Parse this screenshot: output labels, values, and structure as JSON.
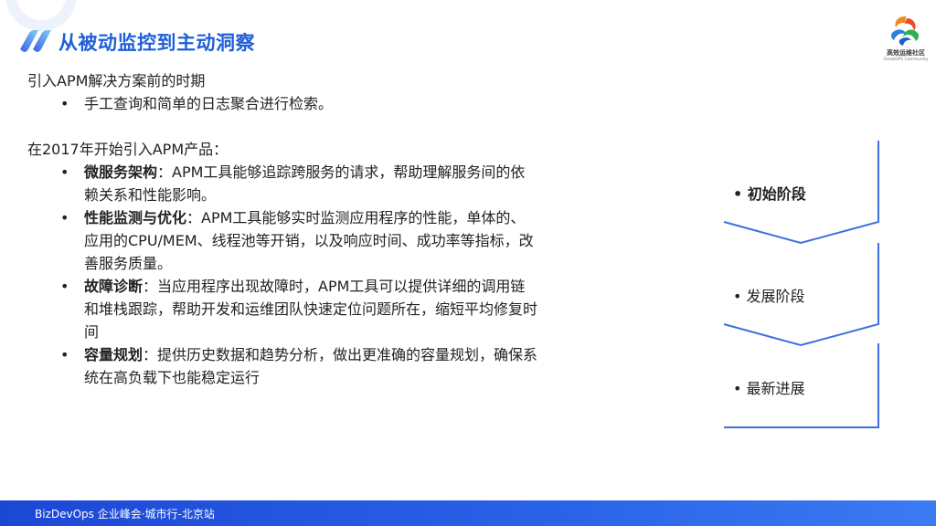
{
  "slide": {
    "title": "从被动监控到主动洞察",
    "footer": "BizDevOps 企业峰会·城市行-北京站"
  },
  "logo": {
    "name": "高效运维社区",
    "sub": "GreatOPS Community"
  },
  "content": {
    "pre_apm_heading": "引入APM解决方案前的时期",
    "pre_apm_bullets": [
      "手工查询和简单的日志聚合进行检索。"
    ],
    "apm_heading": "在2017年开始引入APM产品：",
    "apm_items": [
      {
        "term": "微服务架构",
        "lines": [
          "：APM工具能够追踪跨服务的请求，帮助理解服务间的依",
          "赖关系和性能影响。"
        ]
      },
      {
        "term": "性能监测与优化",
        "lines": [
          "：APM工具能够实时监测应用程序的性能，单体的、",
          "应用的CPU/MEM、线程池等开销，以及响应时间、成功率等指标，改",
          "善服务质量。"
        ]
      },
      {
        "term": "故障诊断",
        "lines": [
          "：当应用程序出现故障时，APM工具可以提供详细的调用链",
          "和堆栈跟踪，帮助开发和运维团队快速定位问题所在，缩短平均修复时",
          "间"
        ]
      },
      {
        "term": "容量规划",
        "lines": [
          "：提供历史数据和趋势分析，做出更准确的容量规划，确保系",
          "统在高负载下也能稳定运行"
        ]
      }
    ],
    "bullet_symbol": "•"
  },
  "stages": [
    {
      "label": "• 初始阶段",
      "active": true
    },
    {
      "label": "• 发展阶段",
      "active": false
    },
    {
      "label": "• 最新进展",
      "active": false
    }
  ],
  "colors": {
    "title": "#1f5fd9",
    "stage_line": "#3f6fe0",
    "footer": "#2a63e8"
  }
}
